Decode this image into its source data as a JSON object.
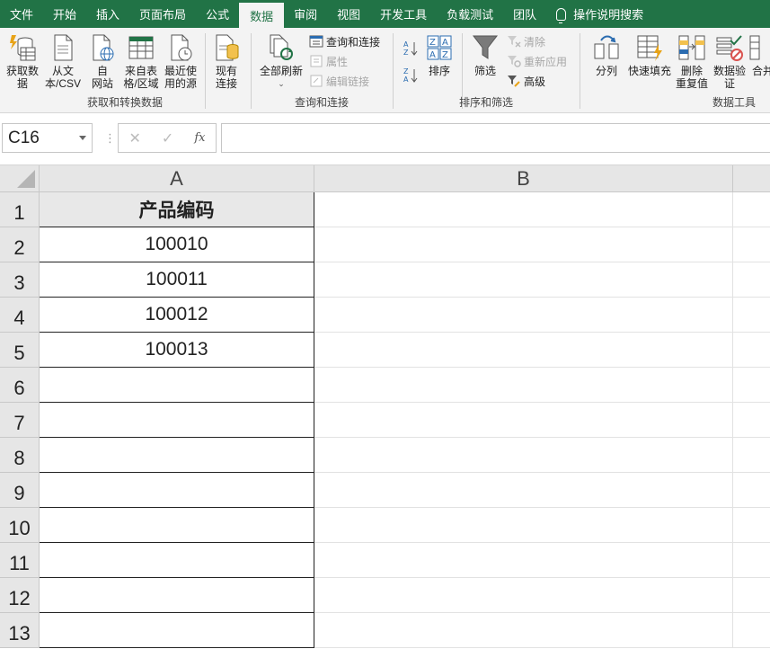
{
  "tabs": [
    {
      "label": "文件",
      "active": false
    },
    {
      "label": "开始",
      "active": false
    },
    {
      "label": "插入",
      "active": false
    },
    {
      "label": "页面布局",
      "active": false
    },
    {
      "label": "公式",
      "active": false
    },
    {
      "label": "数据",
      "active": true
    },
    {
      "label": "审阅",
      "active": false
    },
    {
      "label": "视图",
      "active": false
    },
    {
      "label": "开发工具",
      "active": false
    },
    {
      "label": "负载测试",
      "active": false
    },
    {
      "label": "团队",
      "active": false
    }
  ],
  "tell_me": "操作说明搜索",
  "ribbon": {
    "get_transform": {
      "label": "获取和转换数据",
      "get_data": "获取数\n据",
      "from_text": "从文\n本/CSV",
      "from_web": "自\n网站",
      "from_table": "来自表\n格/区域",
      "recent_sources": "最近使\n用的源",
      "existing_conn": "现有\n连接"
    },
    "queries": {
      "label": "查询和连接",
      "refresh_all": "全部刷新",
      "queries_conn": "查询和连接",
      "properties": "属性",
      "edit_links": "编辑链接"
    },
    "sort_filter": {
      "label": "排序和筛选",
      "sort": "排序",
      "filter": "筛选",
      "clear": "清除",
      "reapply": "重新应用",
      "advanced": "高级"
    },
    "data_tools": {
      "label": "数据工具",
      "split": "分列",
      "flash_fill": "快速填充",
      "remove_dup": "删除\n重复值",
      "validation": "数据验\n证",
      "consolidate": "合并"
    }
  },
  "formula_bar": {
    "name_box": "C16",
    "cancel": "✕",
    "enter": "✓",
    "fx": "fx",
    "value": ""
  },
  "sheet": {
    "columns": [
      "A",
      "B"
    ],
    "rows": [
      "1",
      "2",
      "3",
      "4",
      "5",
      "6",
      "7",
      "8",
      "9",
      "10",
      "11",
      "12",
      "13"
    ],
    "cells_a": [
      "产品编码",
      "100010",
      "100011",
      "100012",
      "100013",
      "",
      "",
      "",
      "",
      "",
      "",
      "",
      ""
    ]
  },
  "colors": {
    "accent": "#217346",
    "ribbon_bg": "#f3f3f3"
  }
}
